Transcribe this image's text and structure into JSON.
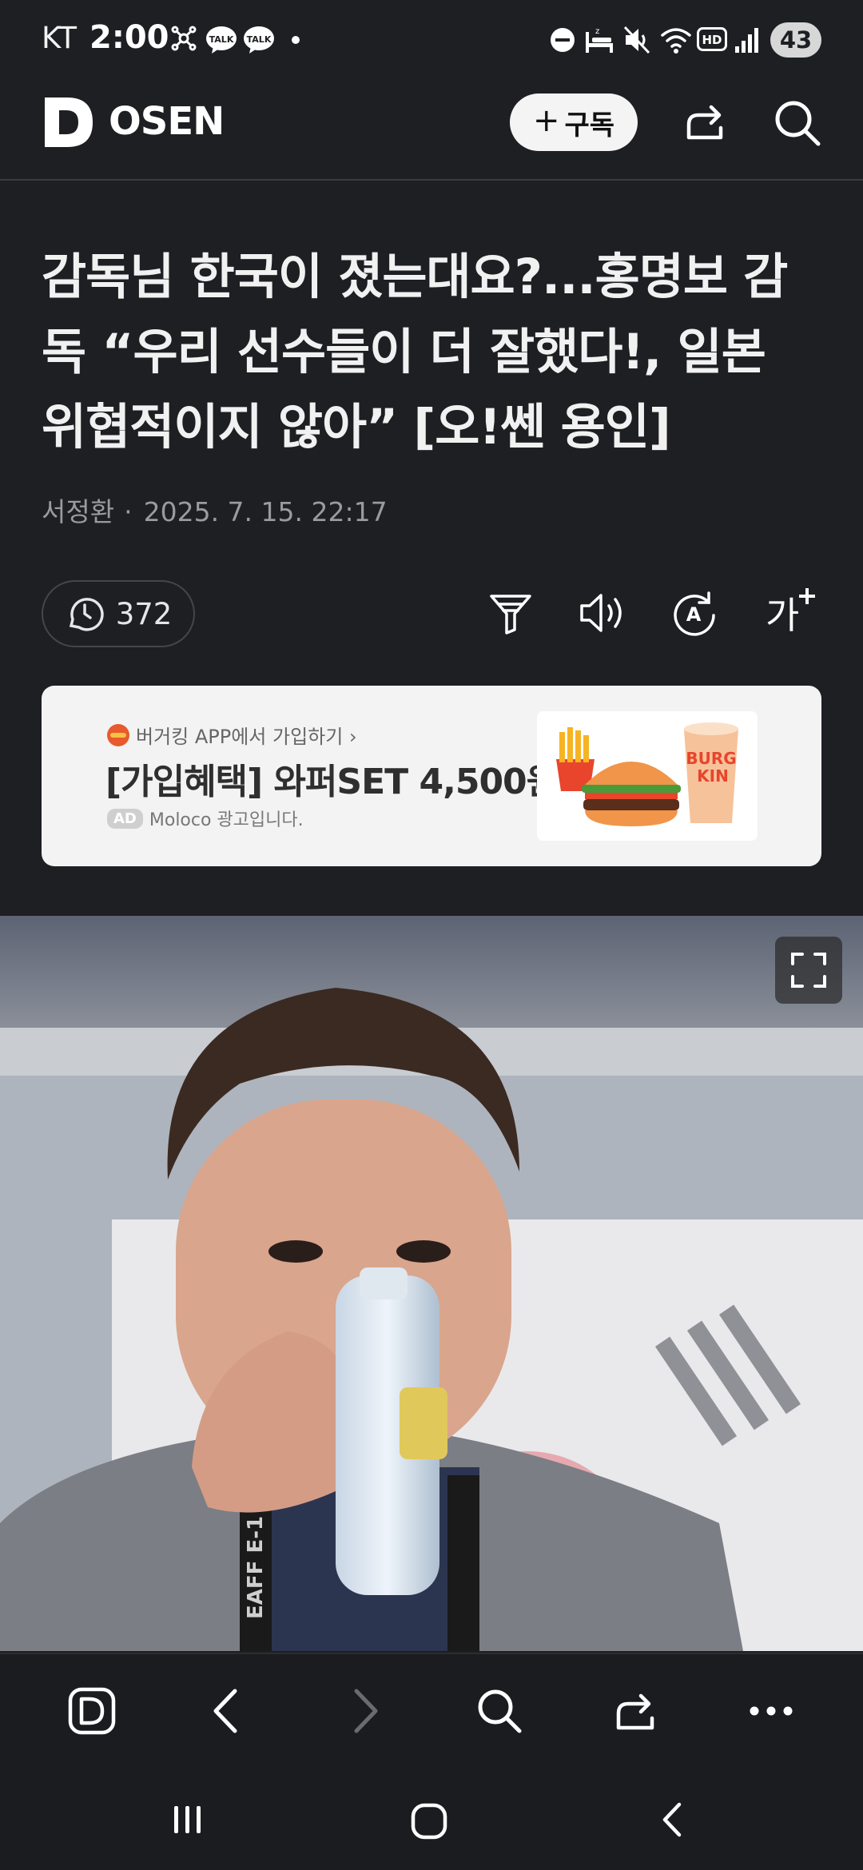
{
  "status_bar": {
    "carrier": "KT",
    "time": "2:00",
    "battery": "43",
    "icons": [
      "network-icon",
      "talk-message-icon",
      "talk-message-icon",
      "dot-icon",
      "do-not-disturb-icon",
      "sleep-icon",
      "mute-icon",
      "wifi-icon",
      "hd-icon",
      "signal-icon",
      "battery-icon"
    ]
  },
  "header": {
    "logo": "OSEN",
    "subscribe_label": "구독",
    "icons": [
      "share-icon",
      "search-icon"
    ]
  },
  "article": {
    "title": "감독님 한국이 졌는대요?...홍명보 감독 “우리 선수들이 더 잘했다!, 일본 위협적이지 않아” [오!쎈 용인]",
    "author": "서정환",
    "timestamp": "2025. 7. 15. 22:17",
    "comment_count": "372"
  },
  "toolbar": {
    "icons": [
      "filter-icon",
      "text-to-speech-icon",
      "auto-translate-icon",
      "font-size-icon"
    ],
    "font_size_label": "가"
  },
  "ad": {
    "brand_line": "버거킹 APP에서 가입하기 ›",
    "headline": "[가입혜택] 와퍼SET 4,500원",
    "ad_tag": "AD",
    "advertiser": "Moloco 광고입니다.",
    "image_text": "BURGER KING"
  },
  "photo": {
    "icons": [
      "fullscreen-icon"
    ],
    "lanyard_text": "EAFF E-1"
  },
  "browser_bar": {
    "icons": [
      "daum-home-icon",
      "back-icon",
      "forward-icon",
      "search-icon",
      "share-icon",
      "more-icon"
    ]
  },
  "system_nav": {
    "icons": [
      "recent-apps-icon",
      "home-icon",
      "back-icon"
    ]
  },
  "colors": {
    "background": "#1e1f23",
    "title_text": "#f1f1f1",
    "meta_text": "#9a9b9f",
    "ad_background": "#f3f3f3",
    "subscribe_button": "#f4f4f4"
  }
}
